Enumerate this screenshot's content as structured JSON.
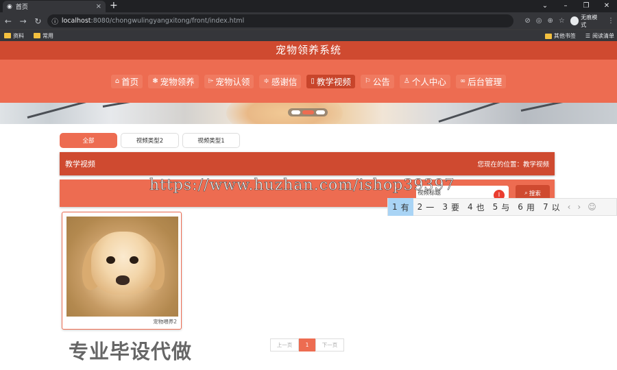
{
  "browser": {
    "tab_title": "首页",
    "url_host": "localhost",
    "url_path": ":8080/chongwulingyangxitong/front/index.html",
    "incognito_label": "无痕模式",
    "bookmarks": [
      "资料",
      "常用"
    ],
    "bookmarks_right": [
      "其他书签",
      "阅读清单"
    ]
  },
  "site": {
    "title": "宠物领养系统",
    "nav": [
      {
        "label": "首页",
        "icon": "home-icon",
        "glyph": "⌂"
      },
      {
        "label": "宠物领养",
        "icon": "gear-icon",
        "glyph": "❃"
      },
      {
        "label": "宠物认领",
        "icon": "tag-icon",
        "glyph": "⌲"
      },
      {
        "label": "感谢信",
        "icon": "list-icon",
        "glyph": "≑"
      },
      {
        "label": "教学视频",
        "icon": "video-icon",
        "glyph": "▯",
        "active": true
      },
      {
        "label": "公告",
        "icon": "flag-icon",
        "glyph": "⚐"
      },
      {
        "label": "个人中心",
        "icon": "user-icon",
        "glyph": "♙"
      },
      {
        "label": "后台管理",
        "icon": "link-icon",
        "glyph": "∞"
      }
    ]
  },
  "categories": [
    "全部",
    "视频类型2",
    "视频类型1"
  ],
  "breadcrumb": {
    "title": "教学视频",
    "location": "您现在的位置：教学视频"
  },
  "search": {
    "placeholder": "视频标题",
    "button_label": "搜索"
  },
  "ime": {
    "candidates": [
      {
        "n": "1",
        "c": "有"
      },
      {
        "n": "2",
        "c": "一"
      },
      {
        "n": "3",
        "c": "要"
      },
      {
        "n": "4",
        "c": "也"
      },
      {
        "n": "5",
        "c": "与"
      },
      {
        "n": "6",
        "c": "用"
      },
      {
        "n": "7",
        "c": "以"
      }
    ],
    "prev": "‹",
    "next": "›",
    "emoji": "☺"
  },
  "cards": [
    {
      "caption": "宠物喂养2"
    }
  ],
  "pager": {
    "prev": "上一页",
    "current": "1",
    "next": "下一页"
  },
  "overlay": {
    "watermark": "https://www.huzhan.com/ishop39397",
    "promo": "专业毕设代做",
    "cursor_glyph": "I"
  },
  "colors": {
    "primary_dark": "#cf4a30",
    "primary": "#ed6c51"
  }
}
